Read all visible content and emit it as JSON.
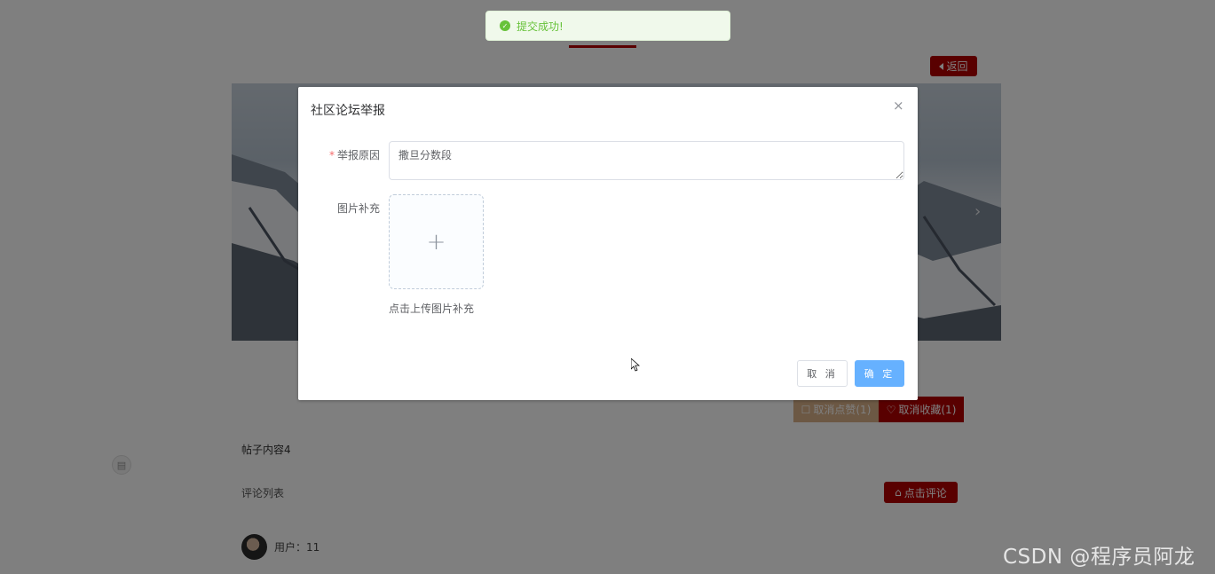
{
  "toast": {
    "icon": "check-circle-icon",
    "message": "提交成功!",
    "color": "#67c23a"
  },
  "page": {
    "back_button": "返回",
    "buttons": {
      "like_label": "取消点赞(1)",
      "favorite_label": "取消收藏(1)"
    },
    "post_content": "帖子内容4",
    "comments": {
      "title": "评论列表",
      "add_comment_label": "点击评论",
      "users": [
        {
          "name": "用户：11"
        }
      ]
    },
    "accent_color": "#b20000"
  },
  "dialog": {
    "title": "社区论坛举报",
    "reason": {
      "label": "举报原因",
      "required_mark": "*",
      "value": "撒旦分数段"
    },
    "image": {
      "label": "图片补充",
      "upload_tip": "点击上传图片补充"
    },
    "cancel_label": "取 消",
    "confirm_label": "确 定",
    "confirm_color": "#66b1ff"
  },
  "watermark": "CSDN @程序员阿龙"
}
